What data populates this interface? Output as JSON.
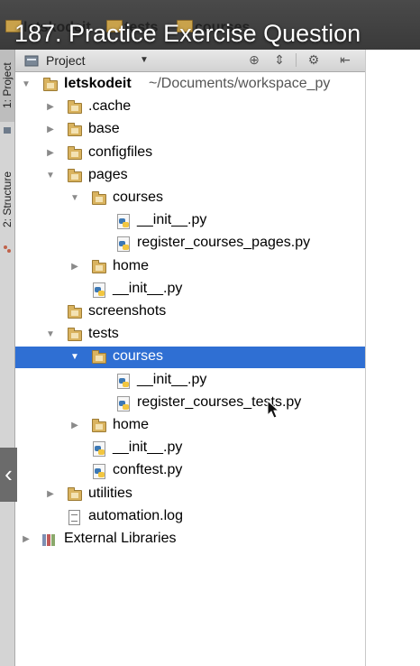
{
  "video_overlay": {
    "title": "187. Practice Exercise Question"
  },
  "breadcrumb": {
    "items": [
      "letskodeit",
      "tests",
      "courses"
    ]
  },
  "tool_strip": {
    "tabs": [
      "1: Project",
      "2: Structure"
    ]
  },
  "toolbar": {
    "view_label": "Project"
  },
  "tree": {
    "root": {
      "name": "letskodeit",
      "path": "~/Documents/workspace_py"
    },
    "items": [
      {
        "label": "letskodeit",
        "type": "folder",
        "depth": 0,
        "expanded": true
      },
      {
        "label": ".cache",
        "type": "folder",
        "depth": 1,
        "expanded": false
      },
      {
        "label": "base",
        "type": "folder",
        "depth": 1,
        "expanded": false
      },
      {
        "label": "configfiles",
        "type": "folder",
        "depth": 1,
        "expanded": false
      },
      {
        "label": "pages",
        "type": "folder",
        "depth": 1,
        "expanded": true
      },
      {
        "label": "courses",
        "type": "folder",
        "depth": 2,
        "expanded": true
      },
      {
        "label": "__init__.py",
        "type": "python",
        "depth": 3
      },
      {
        "label": "register_courses_pages.py",
        "type": "python",
        "depth": 3
      },
      {
        "label": "home",
        "type": "folder",
        "depth": 2,
        "expanded": false
      },
      {
        "label": "__init__.py",
        "type": "python",
        "depth": 2
      },
      {
        "label": "screenshots",
        "type": "folder",
        "depth": 1
      },
      {
        "label": "tests",
        "type": "folder",
        "depth": 1,
        "expanded": true
      },
      {
        "label": "courses",
        "type": "folder",
        "depth": 2,
        "expanded": true,
        "selected": true
      },
      {
        "label": "__init__.py",
        "type": "python",
        "depth": 3
      },
      {
        "label": "register_courses_tests.py",
        "type": "python",
        "depth": 3
      },
      {
        "label": "home",
        "type": "folder",
        "depth": 2,
        "expanded": false
      },
      {
        "label": "__init__.py",
        "type": "python",
        "depth": 2
      },
      {
        "label": "conftest.py",
        "type": "python",
        "depth": 2
      },
      {
        "label": "utilities",
        "type": "folder",
        "depth": 1,
        "expanded": false
      },
      {
        "label": "automation.log",
        "type": "text",
        "depth": 1
      },
      {
        "label": "External Libraries",
        "type": "library",
        "depth": 0,
        "expanded": false
      }
    ]
  },
  "colors": {
    "selection": "#2f6fd3",
    "folder": "#d9b35f",
    "python_blue": "#3c78b5",
    "python_yellow": "#f2c640"
  },
  "icons": {
    "toolbar": [
      "target-icon",
      "collapse-icon",
      "gear-icon",
      "hide-panel-icon"
    ],
    "back": "chevron-left-icon"
  }
}
